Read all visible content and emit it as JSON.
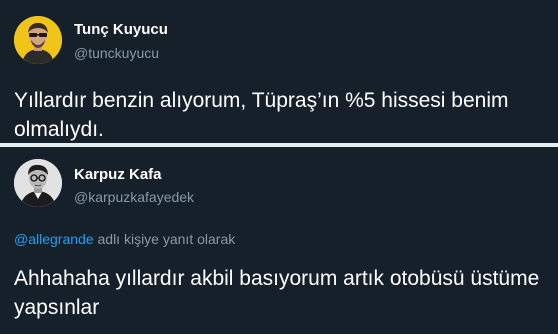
{
  "tweets": [
    {
      "name": "Tunç Kuyucu",
      "handle": "@tunckuyucu",
      "text": "Yıllardır benzin alıyorum, Tüpraş’ın %5 hissesi benim olmalıydı."
    },
    {
      "name": "Karpuz Kafa",
      "handle": "@karpuzkafayedek",
      "reply_to": {
        "mention": "@allegrande",
        "suffix": " adlı kişiye yanıt olarak"
      },
      "text": "Ahhahaha yıllardır akbil basıyorum artık otobüsü üstüme yapsınlar"
    }
  ],
  "colors": {
    "background": "#15202b",
    "text": "#ffffff",
    "secondary_text": "#8899a6",
    "link": "#1da1f2",
    "divider": "#e6ecf0"
  }
}
